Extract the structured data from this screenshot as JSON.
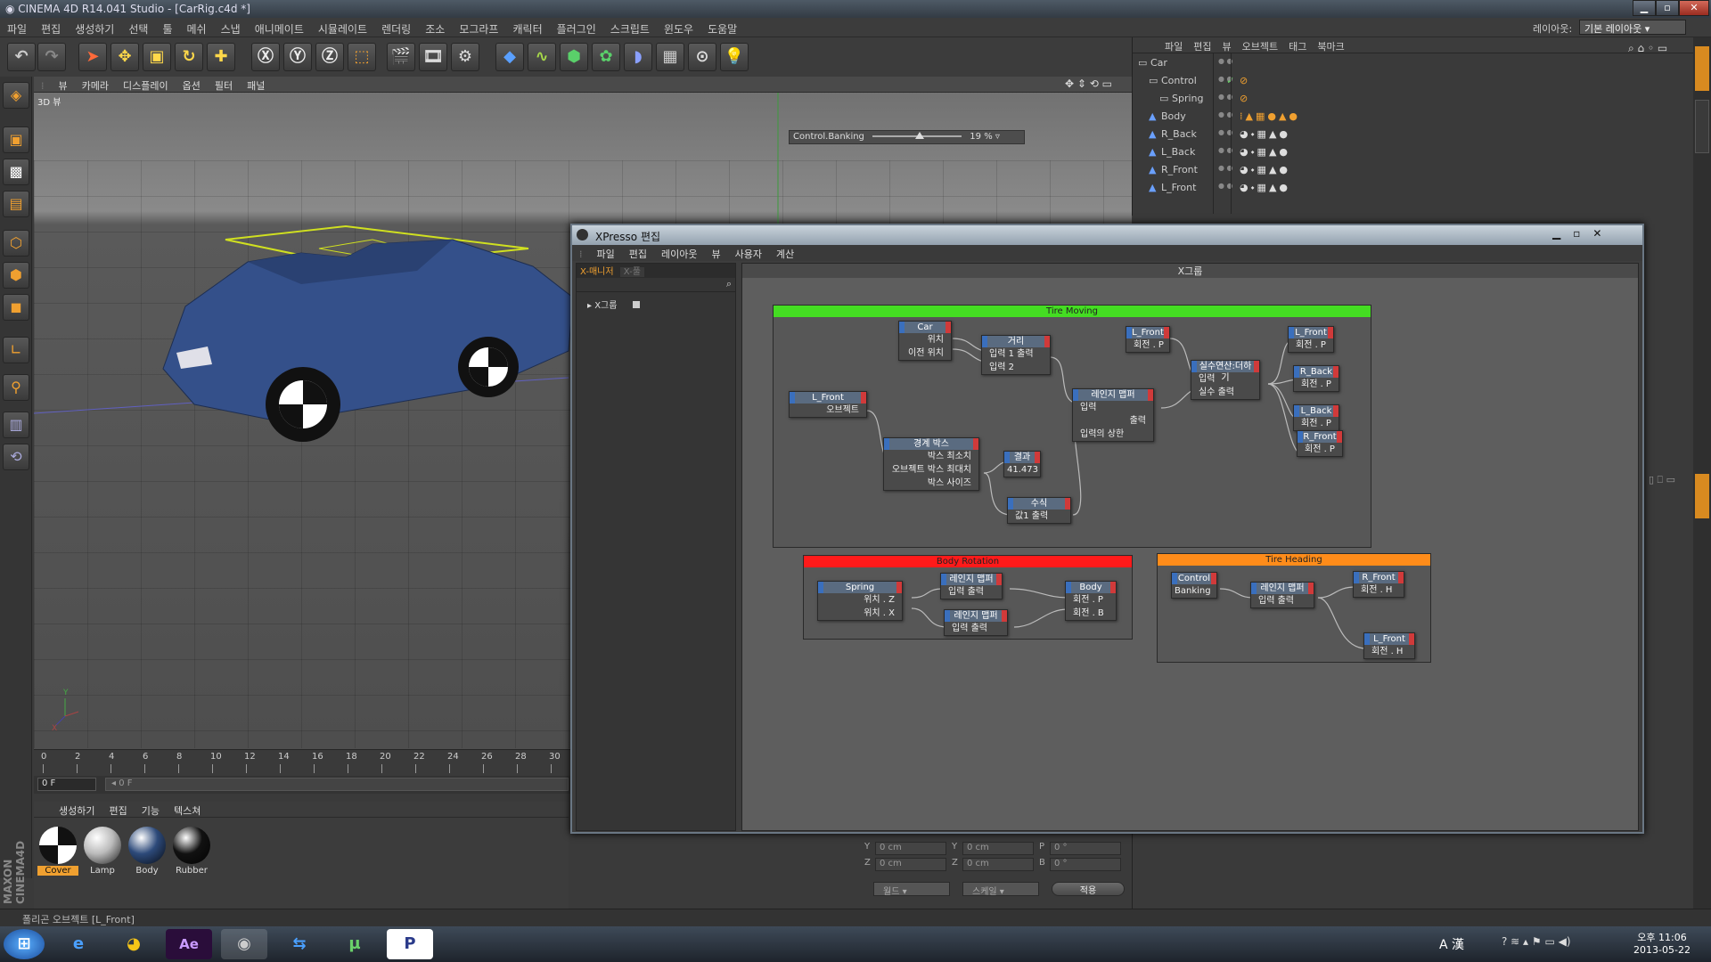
{
  "app_title": "CINEMA 4D R14.041 Studio - [CarRig.c4d *]",
  "menu": [
    "파일",
    "편집",
    "생성하기",
    "선택",
    "툴",
    "메쉬",
    "스냅",
    "애니메이트",
    "시뮬레이트",
    "렌더링",
    "조소",
    "모그라프",
    "캐릭터",
    "플러그인",
    "스크립트",
    "윈도우",
    "도움말"
  ],
  "layout_label": "레이아웃:",
  "layout_value": "기본 레이아웃",
  "viewport": {
    "menu": [
      "뷰",
      "카메라",
      "디스플레이",
      "옵션",
      "필터",
      "패널"
    ],
    "label": "3D 뷰",
    "hud_label": "Control.Banking",
    "hud_value": "19 %",
    "hud_fraction": 0.19
  },
  "timeline": {
    "ticks": [
      "0",
      "2",
      "4",
      "6",
      "8",
      "10",
      "12",
      "14",
      "16",
      "18",
      "20",
      "22",
      "24",
      "26",
      "28",
      "30"
    ],
    "current_frame": "0 F",
    "range_start": "0 F"
  },
  "material_menu": [
    "생성하기",
    "편집",
    "기능",
    "텍스쳐"
  ],
  "materials": [
    {
      "name": "Cover",
      "color": "#ffffff",
      "selected": true
    },
    {
      "name": "Lamp",
      "color": "#bbbbbb",
      "selected": false
    },
    {
      "name": "Body",
      "color": "#2d4a7a",
      "selected": false
    },
    {
      "name": "Rubber",
      "color": "#111111",
      "selected": false
    }
  ],
  "status": "폴리곤 오브젝트 [L_Front]",
  "object_manager": {
    "menu": [
      "파일",
      "편집",
      "뷰",
      "오브젝트",
      "태그",
      "북마크"
    ],
    "objects": [
      "Car",
      "Control",
      "Spring",
      "Body",
      "R_Back",
      "L_Back",
      "R_Front",
      "L_Front"
    ]
  },
  "coords": {
    "rows": [
      [
        "Y",
        "0 cm",
        "Y",
        "0 cm",
        "P",
        "0 °"
      ],
      [
        "Z",
        "0 cm",
        "Z",
        "0 cm",
        "B",
        "0 °"
      ]
    ],
    "mode1": "월드",
    "mode2": "스케일",
    "apply": "적용"
  },
  "xpresso": {
    "title": "XPresso 편집",
    "menu": [
      "파일",
      "편집",
      "레이아웃",
      "뷰",
      "사용자",
      "계산"
    ],
    "tab_manager": "X-매니저",
    "tab_pool": "X-풀",
    "tree_item": "X그룹",
    "canvas_title": "X그룹",
    "groups": {
      "tire_moving": "Tire Moving",
      "body_rotation": "Body Rotation",
      "tire_heading": "Tire Heading"
    },
    "nodes": {
      "car": {
        "title": "Car",
        "p1": "위치",
        "p2": "이전 위치"
      },
      "distance": {
        "title": "거리",
        "p1": "입력 1",
        "p2": "입력 2",
        "out": "출력"
      },
      "lfront_in": {
        "title": "L_Front",
        "p1": "회전 . P"
      },
      "lfront_obj": {
        "title": "L_Front",
        "p1": "오브젝트"
      },
      "range1": {
        "title": "레인지 맵퍼",
        "p1": "입력",
        "p2": "입력의 상한",
        "out": "출력"
      },
      "realmath": {
        "title": "실수연산:더하기",
        "p1": "입력",
        "p2": "실수",
        "out": "출력"
      },
      "bbox": {
        "title": "경계 박스",
        "p1": "박스 최소치",
        "p2": "오브젝트 박스 최대치",
        "p3": "박스 사이즈"
      },
      "result": {
        "title": "결과",
        "p1": "41.473"
      },
      "formula": {
        "title": "수식",
        "p1": "값1",
        "out": "출력"
      },
      "out_lfront": {
        "title": "L_Front",
        "p1": "회전 . P"
      },
      "out_rback": {
        "title": "R_Back",
        "p1": "회전 . P"
      },
      "out_lback": {
        "title": "L_Back",
        "p1": "회전 . P"
      },
      "out_rfront": {
        "title": "R_Front",
        "p1": "회전 . P"
      },
      "spring": {
        "title": "Spring",
        "p1": "위치 . Z",
        "p2": "위치 . X"
      },
      "range2": {
        "title": "레인지 맵퍼",
        "p1": "입력",
        "out": "출력"
      },
      "range3": {
        "title": "레인지 맵퍼",
        "p1": "입력",
        "out": "출력"
      },
      "body": {
        "title": "Body",
        "p1": "회전 . P",
        "p2": "회전 . B"
      },
      "control": {
        "title": "Control",
        "p1": "Banking"
      },
      "range4": {
        "title": "레인지 맵퍼",
        "p1": "입력",
        "out": "출력"
      },
      "h_rfront": {
        "title": "R_Front",
        "p1": "회전 . H"
      },
      "h_lfront": {
        "title": "L_Front",
        "p1": "회전 . H"
      }
    }
  },
  "tray": {
    "ime": "A 漢",
    "time": "오후 11:06",
    "date": "2013-05-22"
  },
  "colors": {
    "green": "#44dd22",
    "red": "#ff1a1a",
    "orange": "#ff8c1a",
    "car_body": "#34508a"
  }
}
